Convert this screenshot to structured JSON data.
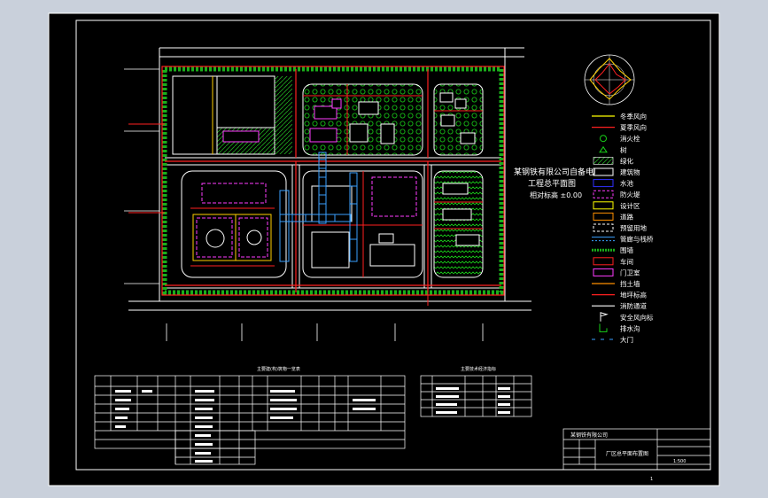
{
  "title_block": {
    "company_line": "某钢铁有限公司",
    "drawing_name": "厂区总平面布置图",
    "scale": "1:500",
    "sheet": "1"
  },
  "plant_labels": {
    "main_title": "某钢铁有限公司自备电厂",
    "title_line2": "工程总平面图",
    "north_note": "相对标高 ±0.00"
  },
  "tables": {
    "left_title": "主要建(构)筑物一览表",
    "right_title": "主要技术经济指标"
  },
  "legend": [
    {
      "label": "冬季风向",
      "icon": "line-yellow"
    },
    {
      "label": "夏季风向",
      "icon": "line-red"
    },
    {
      "label": "消火栓",
      "icon": "hydrant-icon"
    },
    {
      "label": "树",
      "icon": "tree-icon"
    },
    {
      "label": "绿化",
      "icon": "hatch-green"
    },
    {
      "label": "建筑物",
      "icon": "rect-white"
    },
    {
      "label": "水池",
      "icon": "rect-blue"
    },
    {
      "label": "防火堤",
      "icon": "rect-magenta-dash"
    },
    {
      "label": "设计区",
      "icon": "rect-yellow"
    },
    {
      "label": "道路",
      "icon": "rect-orange"
    },
    {
      "label": "预留用地",
      "icon": "rect-white-dash"
    },
    {
      "label": "管廊与栈桥",
      "icon": "pipe-cyan"
    },
    {
      "label": "围墙",
      "icon": "wall-icon"
    },
    {
      "label": "车间",
      "icon": "rect-red"
    },
    {
      "label": "门卫室",
      "icon": "rect-magenta"
    },
    {
      "label": "挡土墙",
      "icon": "line-orange"
    },
    {
      "label": "地坪标高",
      "icon": "line-red"
    },
    {
      "label": "消防通道",
      "icon": "line-white"
    },
    {
      "label": "安全风向标",
      "icon": "flag-icon"
    },
    {
      "label": "排水沟",
      "icon": "drain-icon"
    },
    {
      "label": "大门",
      "icon": "gate-icon"
    }
  ],
  "colors": {
    "background": "#000000",
    "frame": "#ffffff",
    "road": "#ffffff",
    "wall": "#ff2020",
    "green": "#00c800",
    "pipe": "#3aa0ff",
    "building": "#ff3cff",
    "water": "#3030ff",
    "yellow": "#ffff00"
  }
}
